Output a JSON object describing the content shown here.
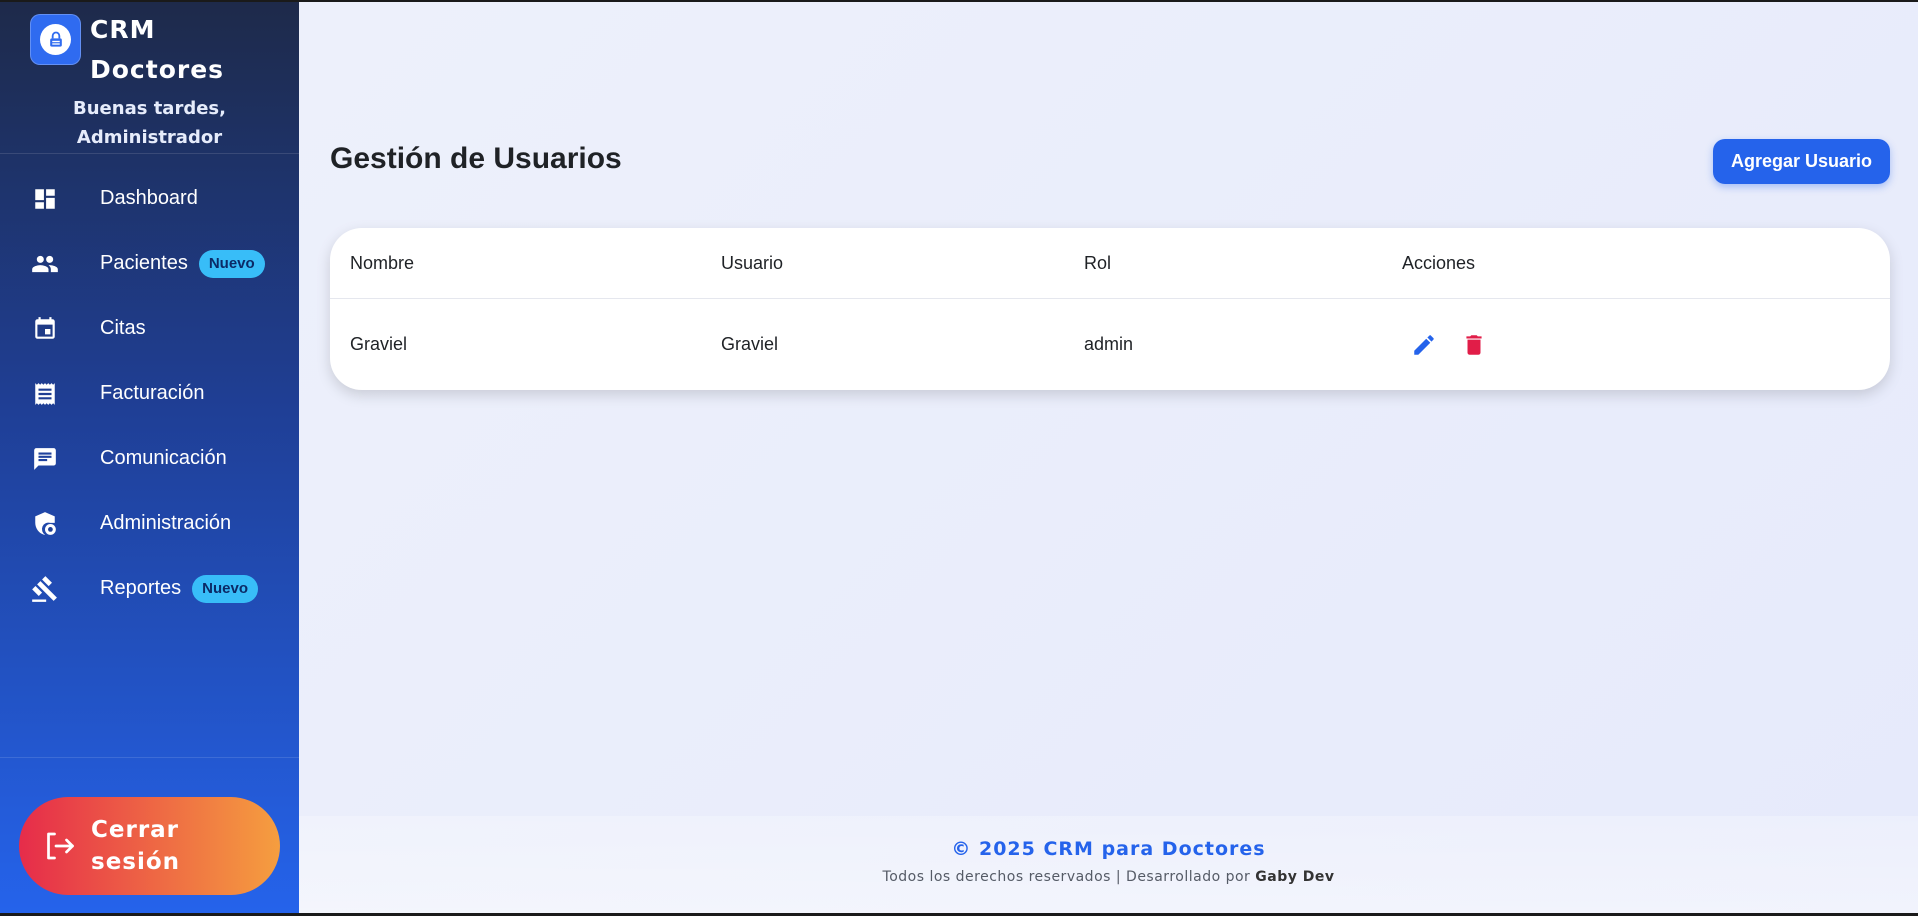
{
  "brand": {
    "title": "CRM Doctores",
    "logo_icon": "lock-icon"
  },
  "sidebar": {
    "greeting": "Buenas tardes, Administrador",
    "items": [
      {
        "label": "Dashboard",
        "icon": "dashboard-icon"
      },
      {
        "label": "Pacientes",
        "icon": "people-icon",
        "badge": "Nuevo"
      },
      {
        "label": "Citas",
        "icon": "calendar-icon"
      },
      {
        "label": "Facturación",
        "icon": "receipt-icon"
      },
      {
        "label": "Comunicación",
        "icon": "chat-icon"
      },
      {
        "label": "Administración",
        "icon": "admin-shield-icon"
      },
      {
        "label": "Reportes",
        "icon": "gavel-icon",
        "badge": "Nuevo"
      }
    ],
    "logout_label": "Cerrar sesión"
  },
  "main": {
    "title": "Gestión de Usuarios",
    "add_button": "Agregar Usuario",
    "table": {
      "columns": [
        "Nombre",
        "Usuario",
        "Rol",
        "Acciones"
      ],
      "rows": [
        {
          "nombre": "Graviel",
          "usuario": "Graviel",
          "rol": "admin"
        }
      ]
    }
  },
  "footer": {
    "copyright": "© 2025 CRM para Doctores",
    "rights_prefix": "Todos los derechos reservados | Desarrollado por",
    "author": "Gaby Dev"
  },
  "colors": {
    "accent": "#2563eb",
    "danger": "#e11d48",
    "badge": "#38bdf8"
  }
}
